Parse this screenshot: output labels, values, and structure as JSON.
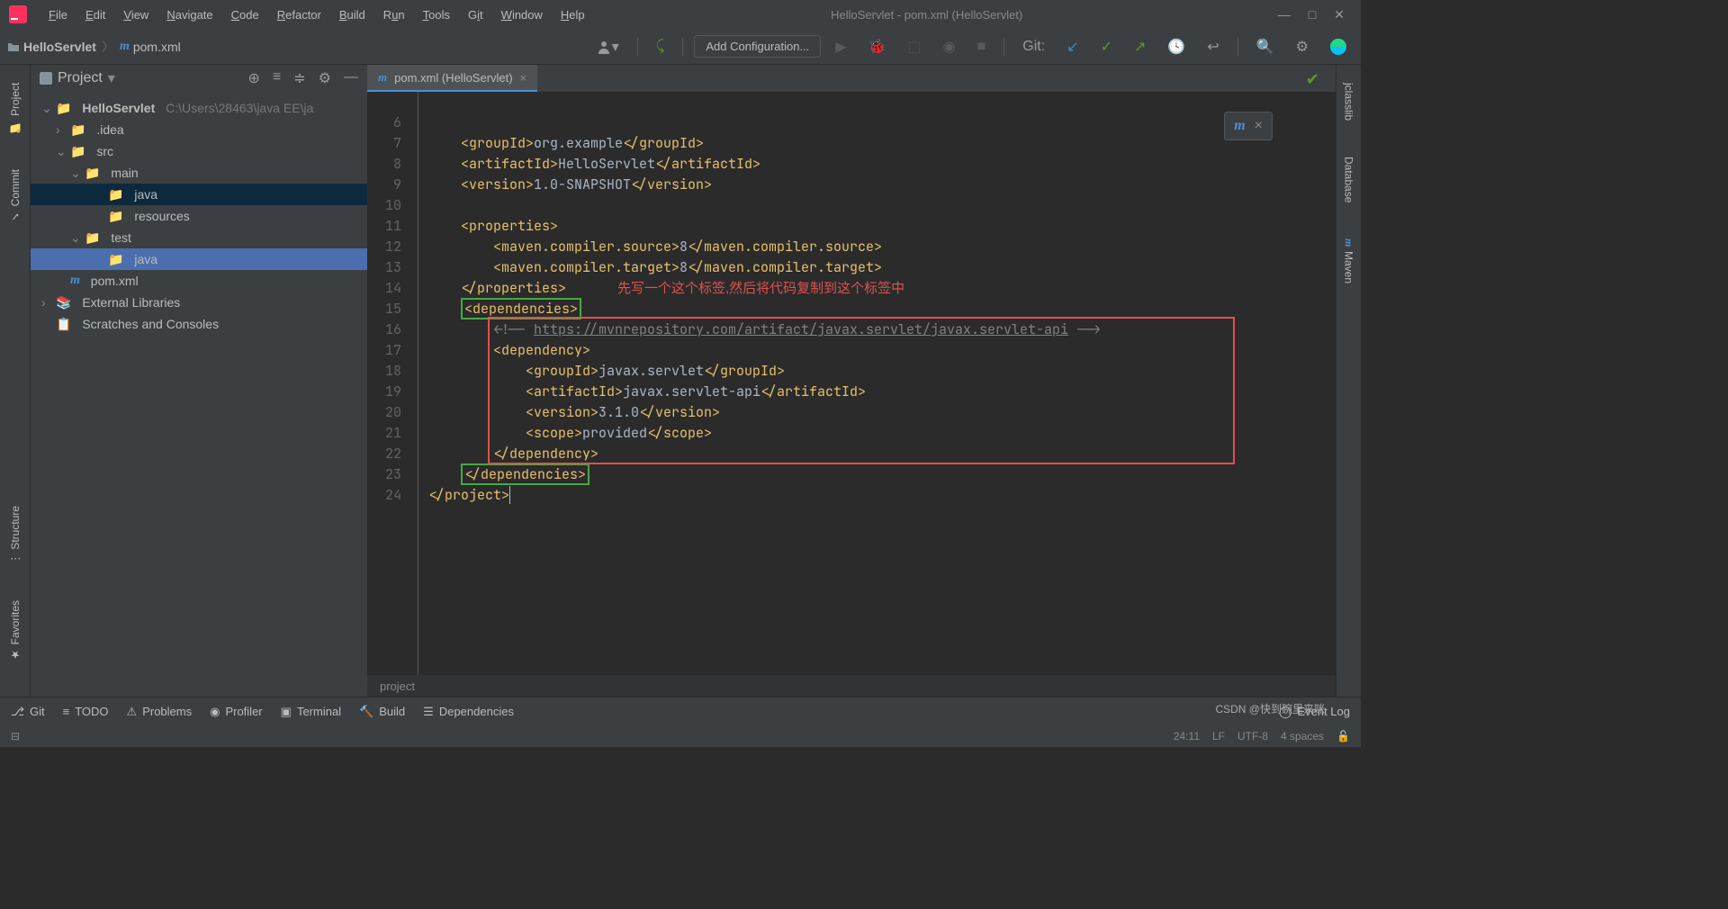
{
  "window_title": "HelloServlet - pom.xml (HelloServlet)",
  "menu": [
    "File",
    "Edit",
    "View",
    "Navigate",
    "Code",
    "Refactor",
    "Build",
    "Run",
    "Tools",
    "Git",
    "Window",
    "Help"
  ],
  "breadcrumb": {
    "root": "HelloServlet",
    "file": "pom.xml"
  },
  "toolbar": {
    "add_config": "Add Configuration...",
    "git_label": "Git:"
  },
  "project_panel": {
    "title": "Project",
    "tree": {
      "root": "HelloServlet",
      "root_path": "C:\\Users\\28463\\java EE\\ja",
      "idea": ".idea",
      "src": "src",
      "main": "main",
      "java_main": "java",
      "resources": "resources",
      "test": "test",
      "java_test": "java",
      "pom": "pom.xml",
      "external": "External Libraries",
      "scratches": "Scratches and Consoles"
    }
  },
  "editor": {
    "tab_label": "pom.xml (HelloServlet)",
    "gutter_lines": [
      "",
      "6",
      "7",
      "8",
      "9",
      "10",
      "11",
      "12",
      "13",
      "14",
      "15",
      "16",
      "17",
      "18",
      "19",
      "20",
      "21",
      "22",
      "23",
      "24"
    ],
    "code": {
      "l7_tag1": "<groupId>",
      "l7_txt": "org.example",
      "l7_tag2": "</groupId>",
      "l8_tag1": "<artifactId>",
      "l8_txt": "HelloServlet",
      "l8_tag2": "</artifactId>",
      "l9_tag1": "<version>",
      "l9_txt": "1.0-SNAPSHOT",
      "l9_tag2": "</version>",
      "l11": "<properties>",
      "l12_tag1": "<maven.compiler.source>",
      "l12_txt": "8",
      "l12_tag2": "</maven.compiler.source>",
      "l13_tag1": "<maven.compiler.target>",
      "l13_txt": "8",
      "l13_tag2": "</maven.compiler.target>",
      "l14": "</properties>",
      "l15": "<dependencies>",
      "l16_c1": "<!-- ",
      "l16_url": "https://mvnrepository.com/artifact/javax.servlet/javax.servlet-api",
      "l16_c2": " -->",
      "l17": "<dependency>",
      "l18_tag1": "<groupId>",
      "l18_txt": "javax.servlet",
      "l18_tag2": "</groupId>",
      "l19_tag1": "<artifactId>",
      "l19_txt": "javax.servlet-api",
      "l19_tag2": "</artifactId>",
      "l20_tag1": "<version>",
      "l20_txt": "3.1.0",
      "l20_tag2": "</version>",
      "l21_tag1": "<scope>",
      "l21_txt": "provided",
      "l21_tag2": "</scope>",
      "l22": "</dependency>",
      "l23": "</dependencies>",
      "l24": "</project>"
    },
    "annotation": "先写一个这个标签,然后将代码复制到这个标签中",
    "bottom_breadcrumb": "project"
  },
  "sidebars": {
    "left": {
      "project": "Project",
      "commit": "Commit",
      "structure": "Structure",
      "favorites": "Favorites"
    },
    "right": {
      "jclasslib": "jclasslib",
      "database": "Database",
      "maven": "Maven"
    }
  },
  "statusbar": {
    "git": "Git",
    "todo": "TODO",
    "problems": "Problems",
    "profiler": "Profiler",
    "terminal": "Terminal",
    "build": "Build",
    "dependencies": "Dependencies",
    "event_log": "Event Log"
  },
  "bottom": {
    "pos": "24:11",
    "lf": "LF",
    "enc": "UTF-8",
    "indent": "4 spaces"
  },
  "watermark": "CSDN @快到碗里来咪"
}
